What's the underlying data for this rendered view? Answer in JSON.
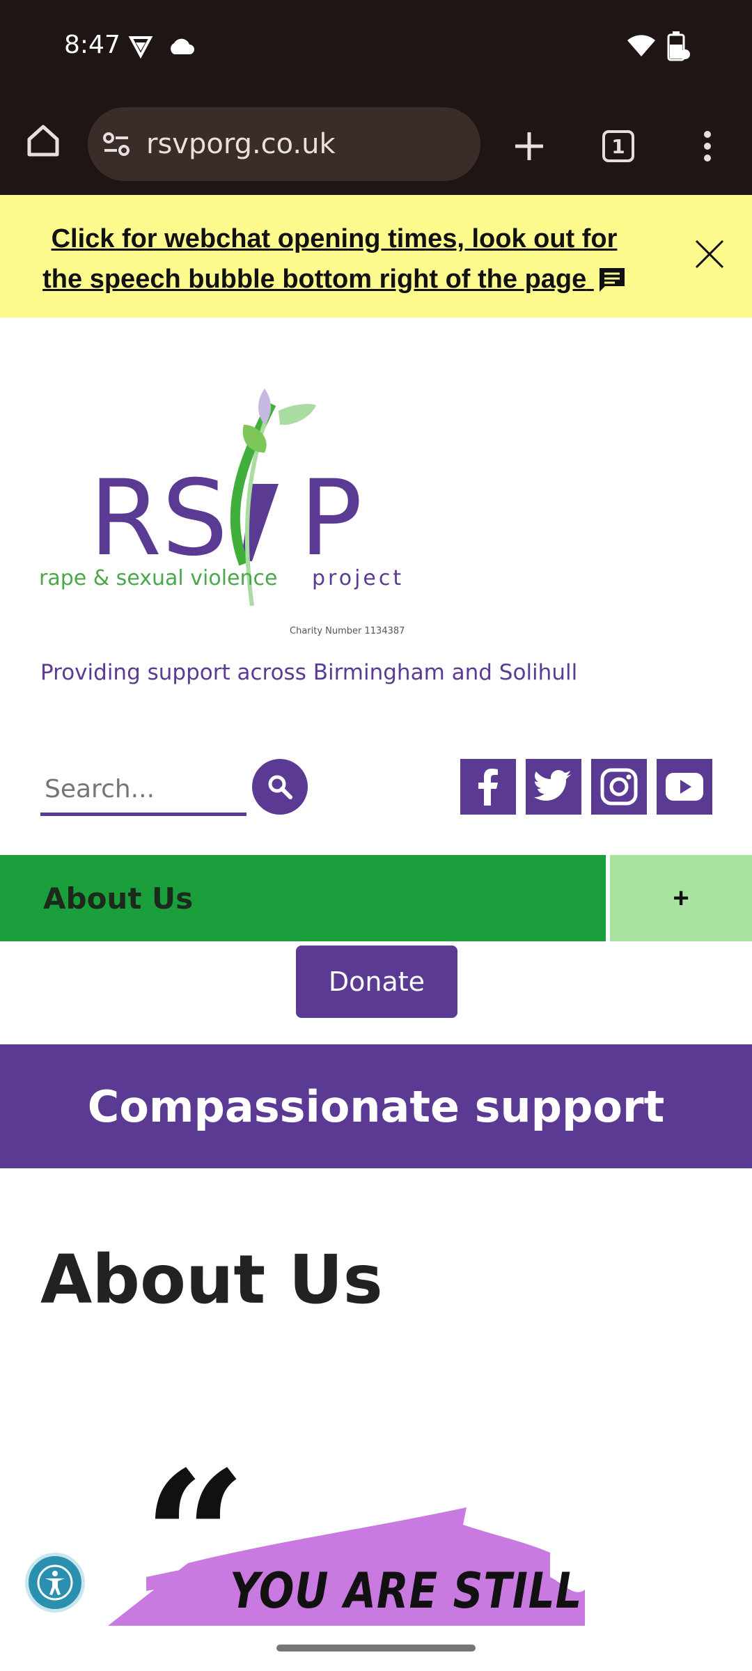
{
  "status_bar": {
    "time": "8:47",
    "icons": [
      "vpn-shield-icon",
      "cloud-icon",
      "wifi-icon",
      "battery-charging-icon"
    ]
  },
  "browser": {
    "url": "rsvporg.co.uk",
    "tab_count": "1",
    "icons": [
      "home-icon",
      "site-settings-icon",
      "new-tab-plus-icon",
      "tab-switcher-icon",
      "overflow-menu-icon"
    ]
  },
  "announcement": {
    "text": "Click for webchat opening times, look out for the speech bubble bottom right of the page",
    "icons": [
      "chat-bubble-icon",
      "close-icon"
    ]
  },
  "logo": {
    "wordmark_left": "RS",
    "wordmark_right": "P",
    "subtitle_left": "rape & sexual violence",
    "subtitle_right": "project",
    "charity_number": "Charity Number  1134387"
  },
  "tagline": "Providing support across Birmingham and Solihull",
  "search": {
    "placeholder": "Search..."
  },
  "social": [
    "facebook-icon",
    "twitter-icon",
    "instagram-icon",
    "youtube-icon"
  ],
  "nav": {
    "current": "About Us",
    "toggle": "+"
  },
  "donate_label": "Donate",
  "banner": "Compassionate support",
  "page_heading": "About Us",
  "quote": {
    "mark": "“",
    "text": "YOU ARE STILL"
  },
  "colors": {
    "brand_purple": "#5b3a94",
    "brand_green": "#1b9e3c",
    "light_green": "#a8e3a0",
    "announce_yellow": "#fdfb8d",
    "quote_pink": "#c97ae0"
  }
}
